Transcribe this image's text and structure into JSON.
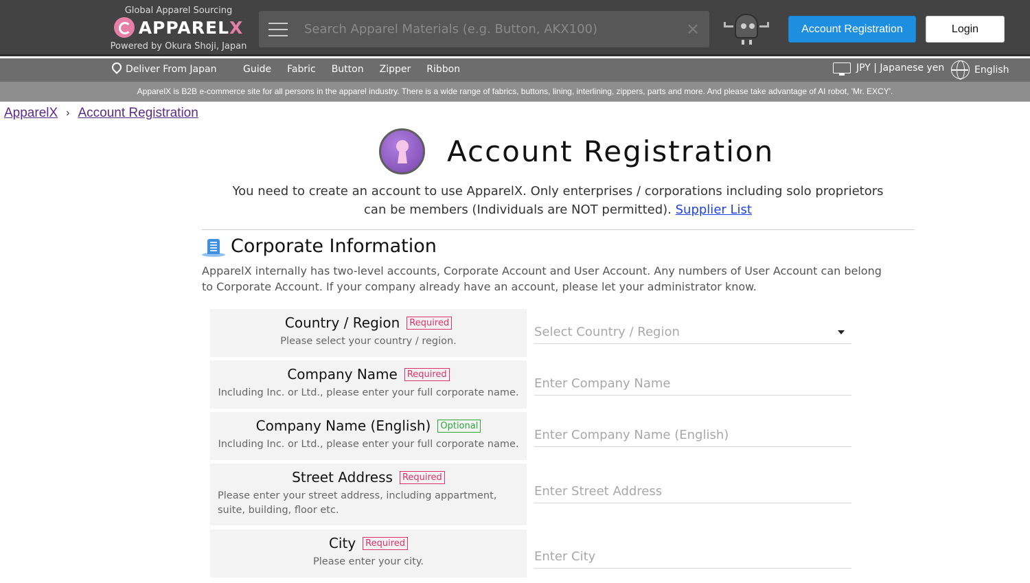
{
  "header": {
    "tagline": "Global Apparel Sourcing",
    "brand_main": "APPAREL",
    "brand_x": "X",
    "powered_by": "Powered by Okura Shoji, Japan",
    "search_placeholder": "Search Apparel Materials (e.g. Button, AKX100)",
    "clear_symbol": "✕",
    "register_label": "Account Registration",
    "login_label": "Login"
  },
  "navbar": {
    "deliver_label": "Deliver From Japan",
    "links": [
      "Guide",
      "Fabric",
      "Button",
      "Zipper",
      "Ribbon"
    ],
    "currency_label": "JPY | Japanese yen",
    "language_label": "English"
  },
  "info_banner": "ApparelX is B2B e-commerce site for all persons in the apparel industry. There is a wide range of fabrics, buttons, lining, interlining, zippers, parts and more. And please take advantage of AI robot, 'Mr. EXCY'.",
  "breadcrumb": {
    "home": "ApparelX",
    "separator": "›",
    "current": "Account Registration"
  },
  "page": {
    "title": "Account Registration",
    "intro_line1": "You need to create an account to use ApparelX. Only enterprises / corporations including solo proprietors",
    "intro_line2": "can be members (Individuals are NOT permitted).",
    "supplier_link": "Supplier List"
  },
  "section": {
    "title": "Corporate Information",
    "description": "ApparelX internally has two-level accounts, Corporate Account and User Account. Any numbers of User Account can belong to Corporate Account. If your company already have an account, please let your administrator know."
  },
  "badges": {
    "required": "Required",
    "optional": "Optional"
  },
  "fields": [
    {
      "label": "Country / Region",
      "badge": "Required",
      "hint": "Please select your country / region.",
      "placeholder": "Select Country / Region",
      "type": "select"
    },
    {
      "label": "Company Name",
      "badge": "Required",
      "hint": "Including Inc. or Ltd., please enter your full corporate name.",
      "placeholder": "Enter Company Name",
      "type": "text"
    },
    {
      "label": "Company Name (English)",
      "badge": "Optional",
      "hint": "Including Inc. or Ltd., please enter your full corporate name.",
      "placeholder": "Enter Company Name (English)",
      "type": "text"
    },
    {
      "label": "Street Address",
      "badge": "Required",
      "hint": "Please enter your street address, including appartment, suite, building, floor etc.",
      "placeholder": "Enter Street Address",
      "type": "text"
    },
    {
      "label": "City",
      "badge": "Required",
      "hint": "Please enter your city.",
      "placeholder": "Enter City",
      "type": "text"
    }
  ],
  "colors": {
    "header_bg": "#434343",
    "primary_button": "#1e8fe0",
    "required_badge": "#e0306a",
    "optional_badge": "#2aa83a",
    "link": "#2043e0",
    "breadcrumb_link": "#5b2a86"
  }
}
